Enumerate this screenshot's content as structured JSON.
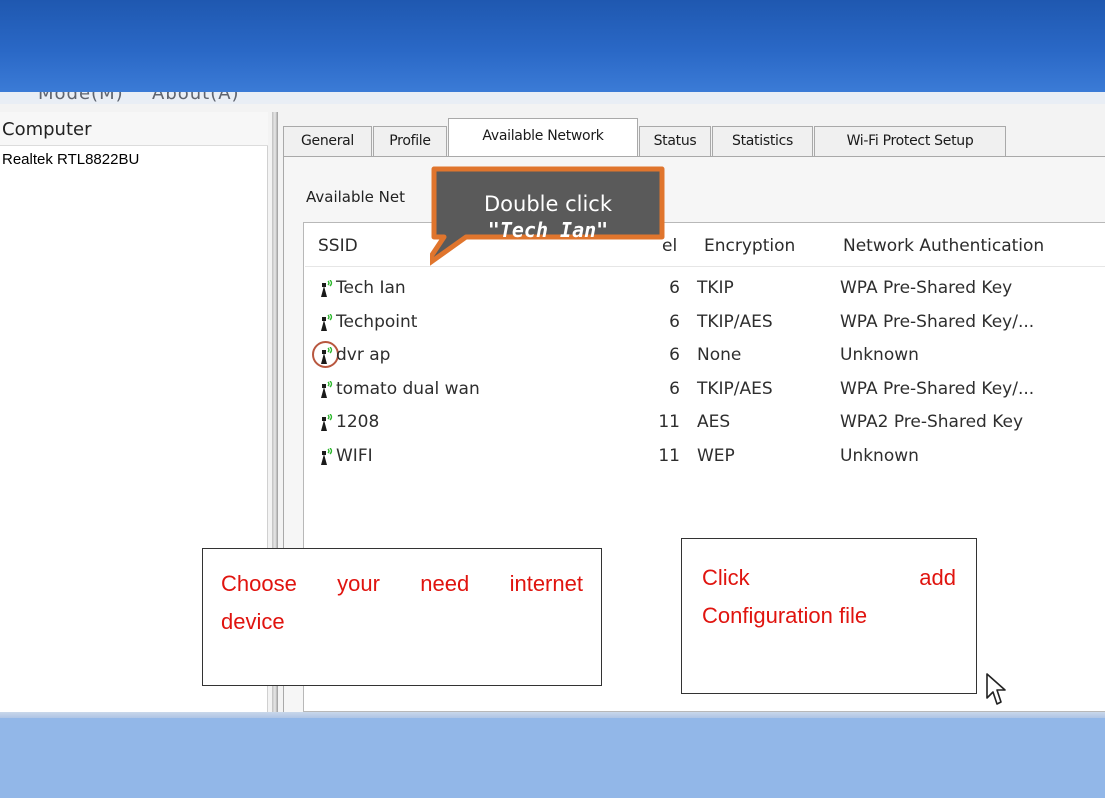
{
  "menu": {
    "items": [
      "Mode(M)",
      "About(A)"
    ]
  },
  "left_panel": {
    "header": "Computer",
    "device": "Realtek RTL8822BU"
  },
  "tabs": [
    {
      "label": "General"
    },
    {
      "label": "Profile"
    },
    {
      "label": "Available Network"
    },
    {
      "label": "Status"
    },
    {
      "label": "Statistics"
    },
    {
      "label": "Wi-Fi Protect Setup"
    }
  ],
  "active_tab": "Available Network",
  "group_label": "Available Net",
  "columns": {
    "ssid": "SSID",
    "channel": "el",
    "encryption": "Encryption",
    "auth": "Network Authentication"
  },
  "networks": [
    {
      "ssid": "Tech Ian",
      "channel": "6",
      "encryption": "TKIP",
      "auth": "WPA Pre-Shared Key"
    },
    {
      "ssid": "Techpoint",
      "channel": "6",
      "encryption": "TKIP/AES",
      "auth": "WPA Pre-Shared Key/..."
    },
    {
      "ssid": "dvr ap",
      "channel": "6",
      "encryption": "None",
      "auth": "Unknown"
    },
    {
      "ssid": "tomato dual wan",
      "channel": "6",
      "encryption": "TKIP/AES",
      "auth": "WPA Pre-Shared Key/..."
    },
    {
      "ssid": "1208",
      "channel": "11",
      "encryption": "AES",
      "auth": "WPA2 Pre-Shared Key"
    },
    {
      "ssid": "WIFI",
      "channel": "11",
      "encryption": "WEP",
      "auth": "Unknown"
    }
  ],
  "callout": {
    "line1": "Double click",
    "line2": "\"Tech Ian\""
  },
  "notes": {
    "left": {
      "words": [
        "Choose",
        "your",
        "need",
        "internet"
      ],
      "line2": "device"
    },
    "right": {
      "word1": "Click",
      "word2": "add",
      "line2": "Configuration file"
    }
  },
  "colors": {
    "title_blue": "#2a68c6",
    "bottom_blue": "#92b7e8",
    "callout_orange": "#e0752d",
    "callout_fill": "#5a5a5a",
    "annotation_red": "#e0140f",
    "signal_green": "#2db82d"
  },
  "icons": {
    "signal": "wifi-signal-icon",
    "cursor": "mouse-pointer-icon"
  }
}
